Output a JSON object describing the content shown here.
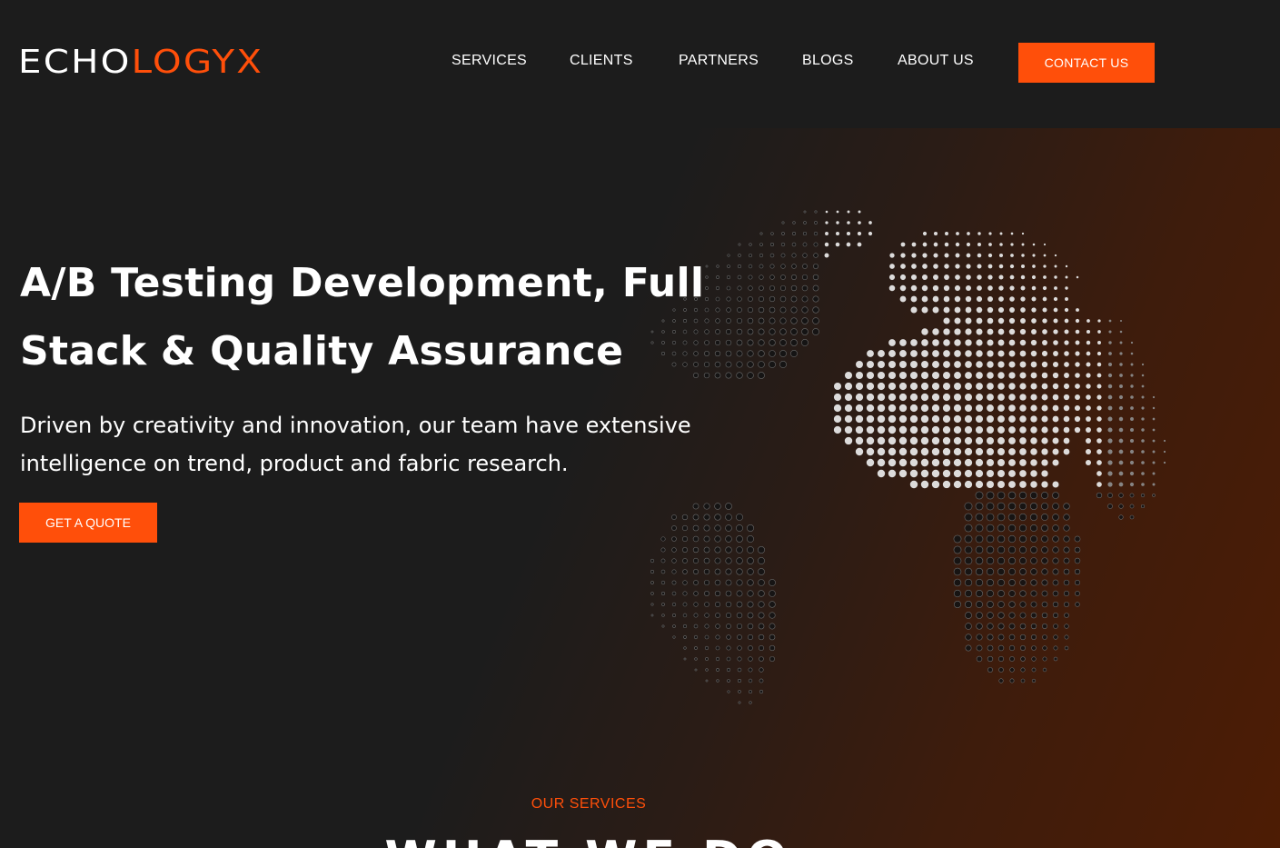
{
  "brand": {
    "logo_part1": "ECHO",
    "logo_part2": "LOGYX",
    "accent_color": "#ff4f0a"
  },
  "nav": {
    "items": [
      {
        "label": "SERVICES"
      },
      {
        "label": "CLIENTS"
      },
      {
        "label": "PARTNERS"
      },
      {
        "label": "BLOGS"
      },
      {
        "label": "ABOUT US"
      }
    ],
    "contact_label": "CONTACT US"
  },
  "hero": {
    "title_line1": "A/B Testing Development, Full",
    "title_line2": "Stack & Quality Assurance",
    "subtitle_line1": "Driven by creativity and innovation, our team have extensive",
    "subtitle_line2": "intelligence on trend, product and fabric research.",
    "cta_label": "GET A QUOTE",
    "globe_icon": "dotted-world-globe"
  },
  "services": {
    "eyebrow": "OUR SERVICES",
    "heading": "WHAT WE DO"
  }
}
